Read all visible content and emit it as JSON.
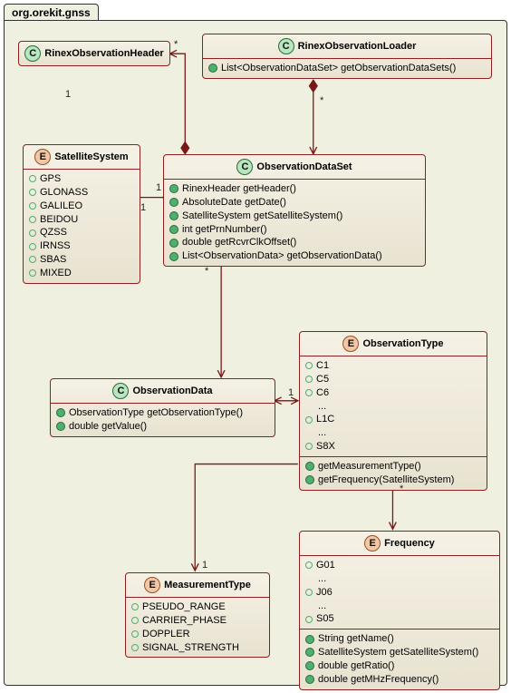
{
  "package": {
    "name": "org.orekit.gnss"
  },
  "classes": {
    "rinexHeader": {
      "name": "RinexObservationHeader",
      "kind": "C"
    },
    "rinexLoader": {
      "name": "RinexObservationLoader",
      "kind": "C",
      "methods": [
        "List<ObservationDataSet> getObservationDataSets()"
      ]
    },
    "satelliteSystem": {
      "name": "SatelliteSystem",
      "kind": "E",
      "values": [
        "GPS",
        "GLONASS",
        "GALILEO",
        "BEIDOU",
        "QZSS",
        "IRNSS",
        "SBAS",
        "MIXED"
      ]
    },
    "obsDataSet": {
      "name": "ObservationDataSet",
      "kind": "C",
      "methods": [
        "RinexHeader getHeader()",
        "AbsoluteDate getDate()",
        "SatelliteSystem getSatelliteSystem()",
        "int getPrnNumber()",
        "double getRcvrClkOffset()",
        "List<ObservationData> getObservationData()"
      ]
    },
    "obsData": {
      "name": "ObservationData",
      "kind": "C",
      "methods": [
        "ObservationType getObservationType()",
        "double getValue()"
      ]
    },
    "obsType": {
      "name": "ObservationType",
      "kind": "E",
      "values": [
        "C1",
        "C5",
        "C6",
        "...",
        "L1C",
        "...",
        "S8X"
      ],
      "methods": [
        "getMeasurementType()",
        "getFrequency(SatelliteSystem)"
      ]
    },
    "measType": {
      "name": "MeasurementType",
      "kind": "E",
      "values": [
        "PSEUDO_RANGE",
        "CARRIER_PHASE",
        "DOPPLER",
        "SIGNAL_STRENGTH"
      ]
    },
    "frequency": {
      "name": "Frequency",
      "kind": "E",
      "values": [
        "G01",
        "...",
        "J06",
        "...",
        "S05"
      ],
      "methods": [
        "String getName()",
        "SatelliteSystem getSatelliteSystem()",
        "double getRatio()",
        "double getMHzFrequency()"
      ]
    }
  },
  "mult": {
    "header_star": "*",
    "header_1": "1",
    "loader_star": "*",
    "satsys_1_left": "1",
    "satsys_1_right": "1",
    "obsdataset_star": "*",
    "obsdata_1": "1",
    "meas_1": "1",
    "freq_star": "*"
  },
  "chart_data": {
    "type": "table",
    "description": "UML class diagram for package org.orekit.gnss",
    "classes": {
      "RinexObservationHeader": {
        "stereotype": "class",
        "members": []
      },
      "RinexObservationLoader": {
        "stereotype": "class",
        "members": [
          "List<ObservationDataSet> getObservationDataSets()"
        ]
      },
      "SatelliteSystem": {
        "stereotype": "enum",
        "values": [
          "GPS",
          "GLONASS",
          "GALILEO",
          "BEIDOU",
          "QZSS",
          "IRNSS",
          "SBAS",
          "MIXED"
        ]
      },
      "ObservationDataSet": {
        "stereotype": "class",
        "members": [
          "RinexHeader getHeader()",
          "AbsoluteDate getDate()",
          "SatelliteSystem getSatelliteSystem()",
          "int getPrnNumber()",
          "double getRcvrClkOffset()",
          "List<ObservationData> getObservationData()"
        ]
      },
      "ObservationData": {
        "stereotype": "class",
        "members": [
          "ObservationType getObservationType()",
          "double getValue()"
        ]
      },
      "ObservationType": {
        "stereotype": "enum",
        "values": [
          "C1",
          "C5",
          "C6",
          "...",
          "L1C",
          "...",
          "S8X"
        ],
        "members": [
          "getMeasurementType()",
          "getFrequency(SatelliteSystem)"
        ]
      },
      "MeasurementType": {
        "stereotype": "enum",
        "values": [
          "PSEUDO_RANGE",
          "CARRIER_PHASE",
          "DOPPLER",
          "SIGNAL_STRENGTH"
        ]
      },
      "Frequency": {
        "stereotype": "enum",
        "values": [
          "G01",
          "...",
          "J06",
          "...",
          "S05"
        ],
        "members": [
          "String getName()",
          "SatelliteSystem getSatelliteSystem()",
          "double getRatio()",
          "double getMHzFrequency()"
        ]
      }
    },
    "relations": [
      {
        "from": "RinexObservationLoader",
        "to": "ObservationDataSet",
        "type": "composition",
        "mult_to": "*"
      },
      {
        "from": "ObservationDataSet",
        "to": "RinexObservationHeader",
        "type": "composition",
        "mult_from": "*",
        "mult_to": "1"
      },
      {
        "from": "ObservationDataSet",
        "to": "SatelliteSystem",
        "type": "association",
        "mult_from": "1",
        "mult_to": "1"
      },
      {
        "from": "ObservationDataSet",
        "to": "ObservationData",
        "type": "composition",
        "mult_to": "*"
      },
      {
        "from": "ObservationData",
        "to": "ObservationType",
        "type": "association",
        "mult_to": "1"
      },
      {
        "from": "ObservationType",
        "to": "MeasurementType",
        "type": "association",
        "mult_to": "1"
      },
      {
        "from": "ObservationType",
        "to": "Frequency",
        "type": "association",
        "mult_to": "*"
      }
    ]
  }
}
